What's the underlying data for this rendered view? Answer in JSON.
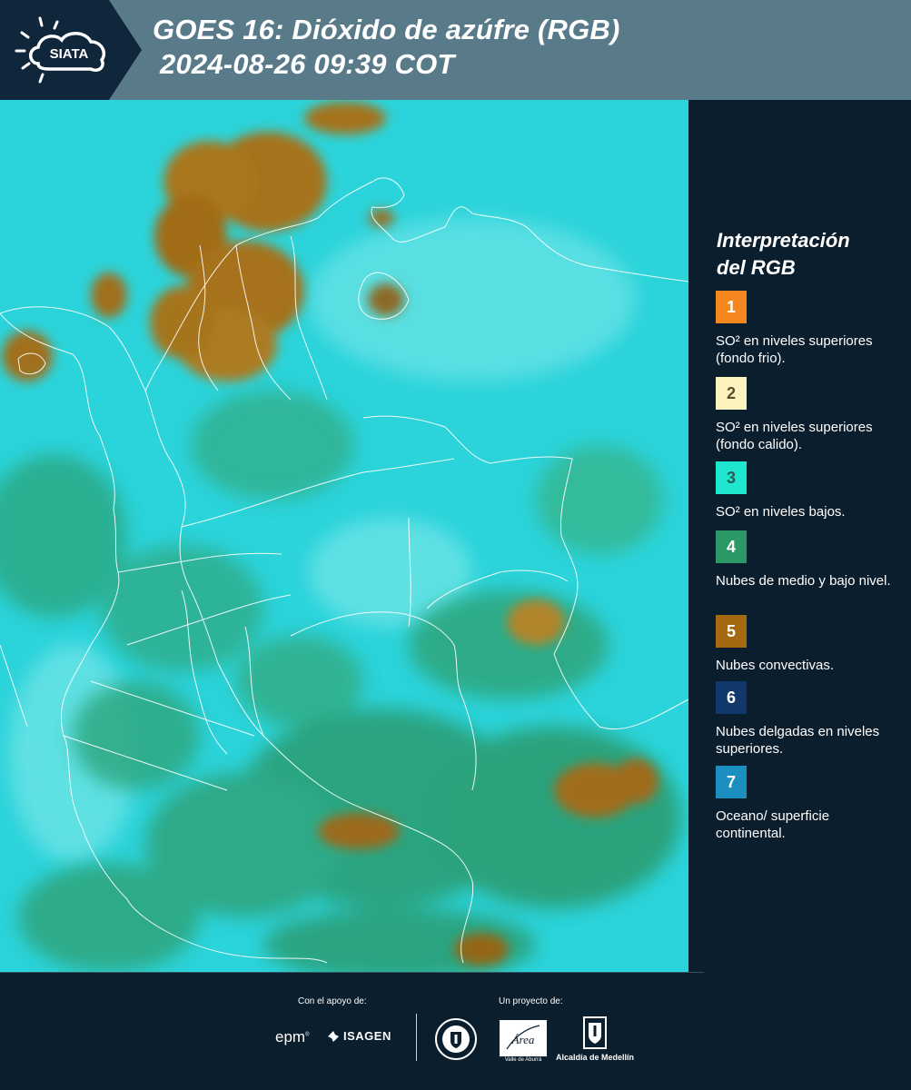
{
  "header": {
    "logo_text": "SIATA",
    "title_line1": "GOES 16: Dióxido de azúfre (RGB)",
    "title_line2": "2024-08-26 09:39 COT"
  },
  "legend": {
    "title_line1": "Interpretación",
    "title_line2": "del RGB",
    "items": [
      {
        "number": "1",
        "color": "#f5871f",
        "text": "SO² en niveles superiores (fondo frio)."
      },
      {
        "number": "2",
        "color": "#fbf3bd",
        "text": "SO² en niveles superiores (fondo calido)."
      },
      {
        "number": "3",
        "color": "#1ee6cf",
        "text": "SO² en niveles bajos."
      },
      {
        "number": "4",
        "color": "#2b9865",
        "text": "Nubes de medio y bajo nivel."
      },
      {
        "number": "5",
        "color": "#a5690f",
        "text": "Nubes convectivas."
      },
      {
        "number": "6",
        "color": "#10386b",
        "text": "Nubes delgadas en niveles superiores."
      },
      {
        "number": "7",
        "color": "#1b8fbf",
        "text": "Oceano/ superficie continental."
      }
    ]
  },
  "footer": {
    "support_label": "Con el apoyo de:",
    "project_label": "Un proyecto de:",
    "epm": "epm",
    "isagen": "ISAGEN",
    "area_text": "Área",
    "area_subtext": "METROPOLITANA Valle de Aburrá",
    "alcaldia": "Alcaldía de Medellín"
  }
}
